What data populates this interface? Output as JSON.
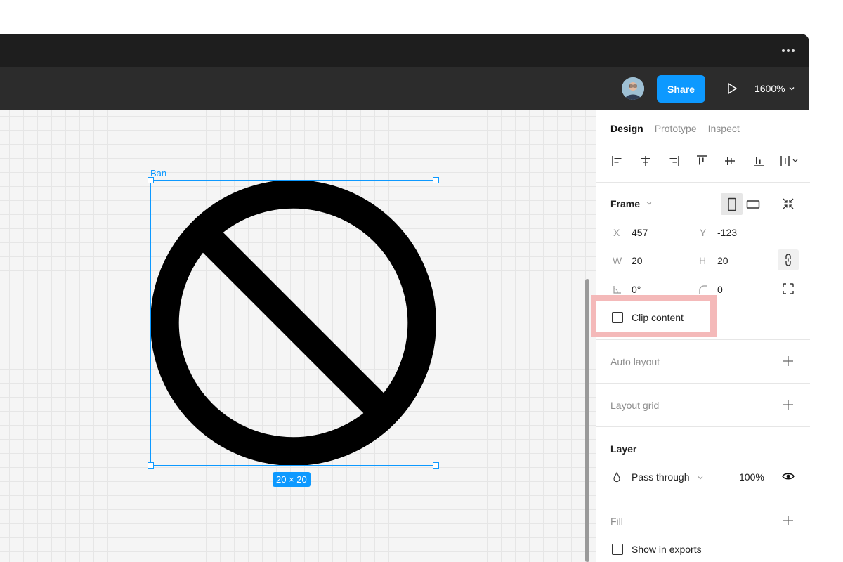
{
  "toolbar": {
    "share_label": "Share",
    "zoom_level": "1600%"
  },
  "canvas": {
    "frame_name": "Ban",
    "size_badge": "20 × 20"
  },
  "panel": {
    "tabs": [
      {
        "label": "Design",
        "active": true
      },
      {
        "label": "Prototype",
        "active": false
      },
      {
        "label": "Inspect",
        "active": false
      }
    ],
    "frame": {
      "title": "Frame",
      "x_label": "X",
      "x_value": "457",
      "y_label": "Y",
      "y_value": "-123",
      "w_label": "W",
      "w_value": "20",
      "h_label": "H",
      "h_value": "20",
      "rotation_value": "0°",
      "radius_value": "0",
      "clip_content_label": "Clip content"
    },
    "auto_layout": {
      "title": "Auto layout"
    },
    "layout_grid": {
      "title": "Layout grid"
    },
    "layer": {
      "title": "Layer",
      "blend_mode": "Pass through",
      "opacity": "100%"
    },
    "fill": {
      "title": "Fill",
      "show_in_exports_label": "Show in exports"
    }
  },
  "colors": {
    "accent": "#0d99ff",
    "titlebar": "#1e1e1e",
    "toolbar": "#2c2c2c",
    "highlight": "#f4b9b9"
  }
}
